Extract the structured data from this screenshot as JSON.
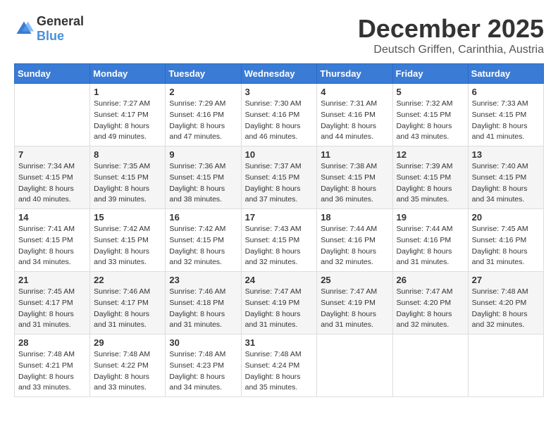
{
  "logo": {
    "text_general": "General",
    "text_blue": "Blue"
  },
  "header": {
    "month": "December 2025",
    "location": "Deutsch Griffen, Carinthia, Austria"
  },
  "days_of_week": [
    "Sunday",
    "Monday",
    "Tuesday",
    "Wednesday",
    "Thursday",
    "Friday",
    "Saturday"
  ],
  "weeks": [
    [
      {
        "day": "",
        "info": ""
      },
      {
        "day": "1",
        "info": "Sunrise: 7:27 AM\nSunset: 4:17 PM\nDaylight: 8 hours\nand 49 minutes."
      },
      {
        "day": "2",
        "info": "Sunrise: 7:29 AM\nSunset: 4:16 PM\nDaylight: 8 hours\nand 47 minutes."
      },
      {
        "day": "3",
        "info": "Sunrise: 7:30 AM\nSunset: 4:16 PM\nDaylight: 8 hours\nand 46 minutes."
      },
      {
        "day": "4",
        "info": "Sunrise: 7:31 AM\nSunset: 4:16 PM\nDaylight: 8 hours\nand 44 minutes."
      },
      {
        "day": "5",
        "info": "Sunrise: 7:32 AM\nSunset: 4:15 PM\nDaylight: 8 hours\nand 43 minutes."
      },
      {
        "day": "6",
        "info": "Sunrise: 7:33 AM\nSunset: 4:15 PM\nDaylight: 8 hours\nand 41 minutes."
      }
    ],
    [
      {
        "day": "7",
        "info": "Sunrise: 7:34 AM\nSunset: 4:15 PM\nDaylight: 8 hours\nand 40 minutes."
      },
      {
        "day": "8",
        "info": "Sunrise: 7:35 AM\nSunset: 4:15 PM\nDaylight: 8 hours\nand 39 minutes."
      },
      {
        "day": "9",
        "info": "Sunrise: 7:36 AM\nSunset: 4:15 PM\nDaylight: 8 hours\nand 38 minutes."
      },
      {
        "day": "10",
        "info": "Sunrise: 7:37 AM\nSunset: 4:15 PM\nDaylight: 8 hours\nand 37 minutes."
      },
      {
        "day": "11",
        "info": "Sunrise: 7:38 AM\nSunset: 4:15 PM\nDaylight: 8 hours\nand 36 minutes."
      },
      {
        "day": "12",
        "info": "Sunrise: 7:39 AM\nSunset: 4:15 PM\nDaylight: 8 hours\nand 35 minutes."
      },
      {
        "day": "13",
        "info": "Sunrise: 7:40 AM\nSunset: 4:15 PM\nDaylight: 8 hours\nand 34 minutes."
      }
    ],
    [
      {
        "day": "14",
        "info": "Sunrise: 7:41 AM\nSunset: 4:15 PM\nDaylight: 8 hours\nand 34 minutes."
      },
      {
        "day": "15",
        "info": "Sunrise: 7:42 AM\nSunset: 4:15 PM\nDaylight: 8 hours\nand 33 minutes."
      },
      {
        "day": "16",
        "info": "Sunrise: 7:42 AM\nSunset: 4:15 PM\nDaylight: 8 hours\nand 32 minutes."
      },
      {
        "day": "17",
        "info": "Sunrise: 7:43 AM\nSunset: 4:15 PM\nDaylight: 8 hours\nand 32 minutes."
      },
      {
        "day": "18",
        "info": "Sunrise: 7:44 AM\nSunset: 4:16 PM\nDaylight: 8 hours\nand 32 minutes."
      },
      {
        "day": "19",
        "info": "Sunrise: 7:44 AM\nSunset: 4:16 PM\nDaylight: 8 hours\nand 31 minutes."
      },
      {
        "day": "20",
        "info": "Sunrise: 7:45 AM\nSunset: 4:16 PM\nDaylight: 8 hours\nand 31 minutes."
      }
    ],
    [
      {
        "day": "21",
        "info": "Sunrise: 7:45 AM\nSunset: 4:17 PM\nDaylight: 8 hours\nand 31 minutes."
      },
      {
        "day": "22",
        "info": "Sunrise: 7:46 AM\nSunset: 4:17 PM\nDaylight: 8 hours\nand 31 minutes."
      },
      {
        "day": "23",
        "info": "Sunrise: 7:46 AM\nSunset: 4:18 PM\nDaylight: 8 hours\nand 31 minutes."
      },
      {
        "day": "24",
        "info": "Sunrise: 7:47 AM\nSunset: 4:19 PM\nDaylight: 8 hours\nand 31 minutes."
      },
      {
        "day": "25",
        "info": "Sunrise: 7:47 AM\nSunset: 4:19 PM\nDaylight: 8 hours\nand 31 minutes."
      },
      {
        "day": "26",
        "info": "Sunrise: 7:47 AM\nSunset: 4:20 PM\nDaylight: 8 hours\nand 32 minutes."
      },
      {
        "day": "27",
        "info": "Sunrise: 7:48 AM\nSunset: 4:20 PM\nDaylight: 8 hours\nand 32 minutes."
      }
    ],
    [
      {
        "day": "28",
        "info": "Sunrise: 7:48 AM\nSunset: 4:21 PM\nDaylight: 8 hours\nand 33 minutes."
      },
      {
        "day": "29",
        "info": "Sunrise: 7:48 AM\nSunset: 4:22 PM\nDaylight: 8 hours\nand 33 minutes."
      },
      {
        "day": "30",
        "info": "Sunrise: 7:48 AM\nSunset: 4:23 PM\nDaylight: 8 hours\nand 34 minutes."
      },
      {
        "day": "31",
        "info": "Sunrise: 7:48 AM\nSunset: 4:24 PM\nDaylight: 8 hours\nand 35 minutes."
      },
      {
        "day": "",
        "info": ""
      },
      {
        "day": "",
        "info": ""
      },
      {
        "day": "",
        "info": ""
      }
    ]
  ]
}
